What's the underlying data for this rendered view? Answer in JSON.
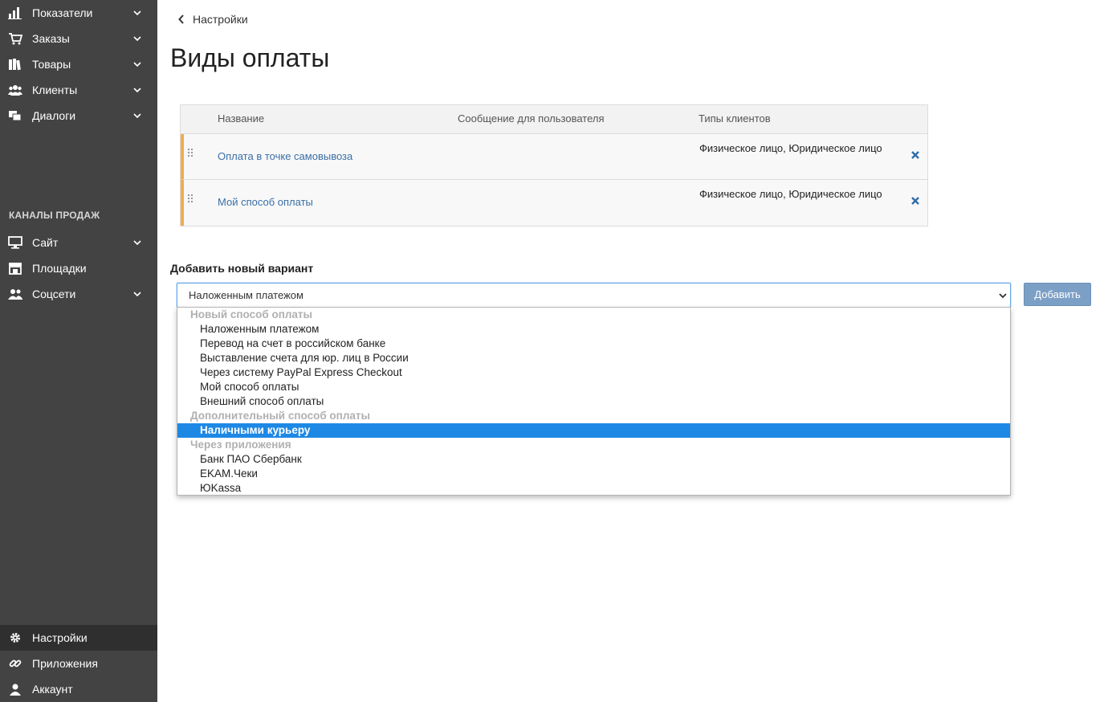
{
  "sidebar": {
    "top_items": [
      {
        "label": "Показатели",
        "icon": "bar-chart-icon"
      },
      {
        "label": "Заказы",
        "icon": "cart-icon"
      },
      {
        "label": "Товары",
        "icon": "books-icon"
      },
      {
        "label": "Клиенты",
        "icon": "users-icon"
      },
      {
        "label": "Диалоги",
        "icon": "chat-icon"
      }
    ],
    "section_title": "КАНАЛЫ ПРОДАЖ",
    "channel_items": [
      {
        "label": "Сайт",
        "icon": "monitor-icon"
      },
      {
        "label": "Площадки",
        "icon": "store-icon"
      },
      {
        "label": "Соцсети",
        "icon": "people-icon"
      }
    ],
    "bottom_items": [
      {
        "label": "Настройки",
        "icon": "gear-icon",
        "active": true
      },
      {
        "label": "Приложения",
        "icon": "link-icon"
      },
      {
        "label": "Аккаунт",
        "icon": "user-icon"
      }
    ]
  },
  "header": {
    "back_label": "Настройки",
    "title": "Виды оплаты"
  },
  "table": {
    "columns": [
      "Название",
      "Сообщение для пользователя",
      "Типы клиентов"
    ],
    "rows": [
      {
        "name": "Оплата в точке самовывоза",
        "message": "",
        "client_types": "Физическое лицо, Юридическое лицо"
      },
      {
        "name": "Мой способ оплаты",
        "message": "",
        "client_types": "Физическое лицо, Юридическое лицо"
      }
    ]
  },
  "add_form": {
    "label": "Добавить новый вариант",
    "selected_value": "Наложенным платежом",
    "button_label": "Добавить",
    "dropdown": [
      {
        "type": "group",
        "label": "Новый способ оплаты"
      },
      {
        "type": "option",
        "label": "Наложенным платежом"
      },
      {
        "type": "option",
        "label": "Перевод на счет в российском банке"
      },
      {
        "type": "option",
        "label": "Выставление счета для юр. лиц в России"
      },
      {
        "type": "option",
        "label": "Через систему PayPal Express Checkout"
      },
      {
        "type": "option",
        "label": "Мой способ оплаты"
      },
      {
        "type": "option",
        "label": "Внешний способ оплаты"
      },
      {
        "type": "group",
        "label": "Дополнительный способ оплаты"
      },
      {
        "type": "option",
        "label": "Наличными курьеру",
        "highlighted": true
      },
      {
        "type": "group",
        "label": "Через приложения"
      },
      {
        "type": "option",
        "label": "Банк ПАО Сбербанк"
      },
      {
        "type": "option",
        "label": "EKAM.Чеки"
      },
      {
        "type": "option",
        "label": "ЮKassa"
      }
    ]
  },
  "colors": {
    "sidebar_bg": "#434343",
    "sidebar_active": "#2f2f2f",
    "link": "#3a6fa6",
    "row_accent": "#f0ad4e",
    "option_highlight": "#1e88e5",
    "button_bg": "#7c9fc6"
  }
}
